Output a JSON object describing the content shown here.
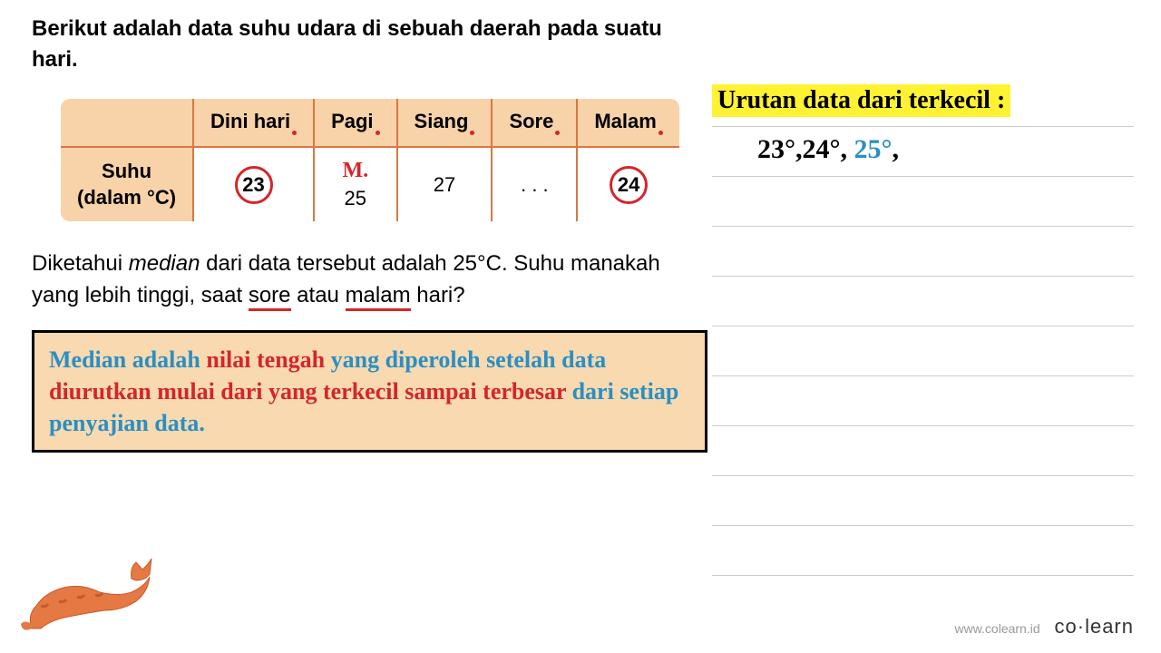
{
  "intro": "Berikut adalah data suhu udara di sebuah daerah pada suatu hari.",
  "table": {
    "headers": [
      "Dini hari",
      "Pagi",
      "Siang",
      "Sore",
      "Malam"
    ],
    "row_label_line1": "Suhu",
    "row_label_line2": "(dalam °C)",
    "values": [
      "23",
      "25",
      "27",
      ". . .",
      "24"
    ],
    "m_annotation": "M."
  },
  "question": {
    "part1": "Diketahui ",
    "median_word": "median",
    "part2": " dari data tersebut adalah 25°C. Suhu manakah yang lebih tinggi, saat ",
    "sore": "sore",
    "part3": " atau ",
    "malam": "malam",
    "part4": " hari?"
  },
  "definition": {
    "w1": "Median adalah ",
    "w2": "nilai tengah ",
    "w3": "yang diperoleh setelah data ",
    "w4": "diurutkan mulai dari yang terkecil sampai terbesar ",
    "w5": "dari setiap penyajian data."
  },
  "right": {
    "title": "Urutan data dari terkecil :",
    "v1": "23°",
    "c1": ",",
    "v2": "24°",
    "c2": ", ",
    "v3": "25°",
    "c3": ","
  },
  "footer": {
    "url": "www.colearn.id",
    "brand": "co·learn"
  }
}
